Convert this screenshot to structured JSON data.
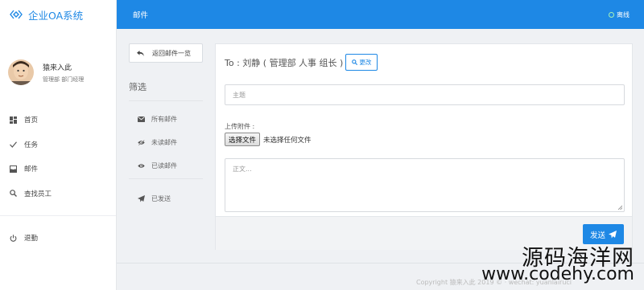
{
  "app": {
    "brand": "企业OA系统"
  },
  "user": {
    "name": "猿来入此",
    "role": "管理部 部门经理"
  },
  "sidebar": {
    "items": [
      {
        "label": "首页",
        "icon": "dashboard-icon"
      },
      {
        "label": "任务",
        "icon": "check-icon"
      },
      {
        "label": "邮件",
        "icon": "inbox-icon"
      },
      {
        "label": "查找员工",
        "icon": "search-icon"
      }
    ],
    "logout": "退勤"
  },
  "header": {
    "title": "邮件",
    "status": "离线"
  },
  "filter": {
    "back_label": "返回邮件一览",
    "title": "筛选",
    "items": [
      {
        "label": "所有邮件",
        "icon": "envelope-icon"
      },
      {
        "label": "未读邮件",
        "icon": "eye-slash-icon"
      },
      {
        "label": "已读邮件",
        "icon": "eye-icon"
      }
    ],
    "sent": {
      "label": "已发送",
      "icon": "send-icon"
    }
  },
  "compose": {
    "to_text": "To : 刘静 ( 管理部 人事 组长 )",
    "change_label": "更改",
    "subject_placeholder": "主题",
    "attach_label": "上传附件 :",
    "file_button": "选择文件",
    "file_status": "未选择任何文件",
    "body_placeholder": "正文...",
    "send_label": "发送"
  },
  "footer": {
    "copyright": "Copyright 猿来入此 2019 © · wechat: yuanlairuci"
  },
  "watermark": {
    "line1": "源码海洋网",
    "line2": "www.codehy.com"
  },
  "colors": {
    "primary": "#1e88e5",
    "online": "#a5f2b6"
  }
}
